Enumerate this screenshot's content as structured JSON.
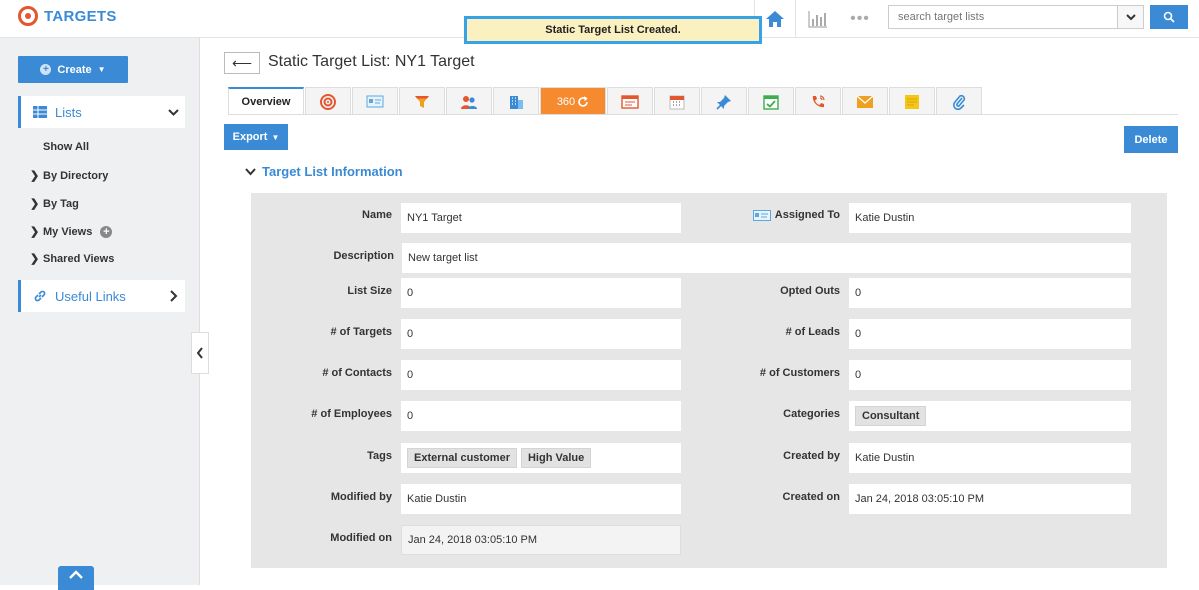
{
  "app": {
    "title": "TARGETS"
  },
  "toast": "Static Target List Created.",
  "topnav": {
    "search_placeholder": "search target lists",
    "more": "•••"
  },
  "sidebar": {
    "create_label": "Create",
    "lists_label": "Lists",
    "links": [
      "Show All",
      "By Directory",
      "By Tag",
      "My Views",
      "Shared Views"
    ],
    "useful_links_label": "Useful Links"
  },
  "page": {
    "title": "Static Target List: NY1 Target"
  },
  "tabs": {
    "overview": "Overview",
    "view360": "360"
  },
  "actions": {
    "export_label": "Export",
    "delete_label": "Delete"
  },
  "section": {
    "title": "Target List Information"
  },
  "fields": {
    "name": {
      "label": "Name",
      "value": "NY1 Target"
    },
    "assigned_to": {
      "label": "Assigned To",
      "value": "Katie Dustin"
    },
    "description": {
      "label": "Description",
      "value": "New target list"
    },
    "list_size": {
      "label": "List Size",
      "value": "0"
    },
    "opted_outs": {
      "label": "Opted Outs",
      "value": "0"
    },
    "num_targets": {
      "label": "# of Targets",
      "value": "0"
    },
    "num_leads": {
      "label": "# of Leads",
      "value": "0"
    },
    "num_contacts": {
      "label": "# of Contacts",
      "value": "0"
    },
    "num_customers": {
      "label": "# of Customers",
      "value": "0"
    },
    "num_employees": {
      "label": "# of Employees",
      "value": "0"
    },
    "categories": {
      "label": "Categories",
      "value": "Consultant"
    },
    "tags": {
      "label": "Tags",
      "values": [
        "External customer",
        "High Value"
      ]
    },
    "created_by": {
      "label": "Created by",
      "value": "Katie Dustin"
    },
    "modified_by": {
      "label": "Modified by",
      "value": "Katie Dustin"
    },
    "created_on": {
      "label": "Created on",
      "value": "Jan 24, 2018 03:05:10 PM"
    },
    "modified_on": {
      "label": "Modified on",
      "value": "Jan 24, 2018 03:05:10 PM"
    }
  },
  "colors": {
    "accent": "#3a8ad6",
    "brand_icon": "#e4572e",
    "toast_bg": "#faf0c0",
    "toast_border": "#36a3e6",
    "tab_360": "#f58a2f"
  },
  "icons": [
    "target-logo-icon",
    "home-icon",
    "bar-chart-icon",
    "search-icon",
    "list-icon",
    "link-icon",
    "target-icon",
    "vcard-icon",
    "funnel-icon",
    "people-icon",
    "building-icon",
    "refresh-icon",
    "calendar-icon",
    "pin-icon",
    "call-icon",
    "mail-icon",
    "note-icon",
    "paperclip-icon"
  ]
}
